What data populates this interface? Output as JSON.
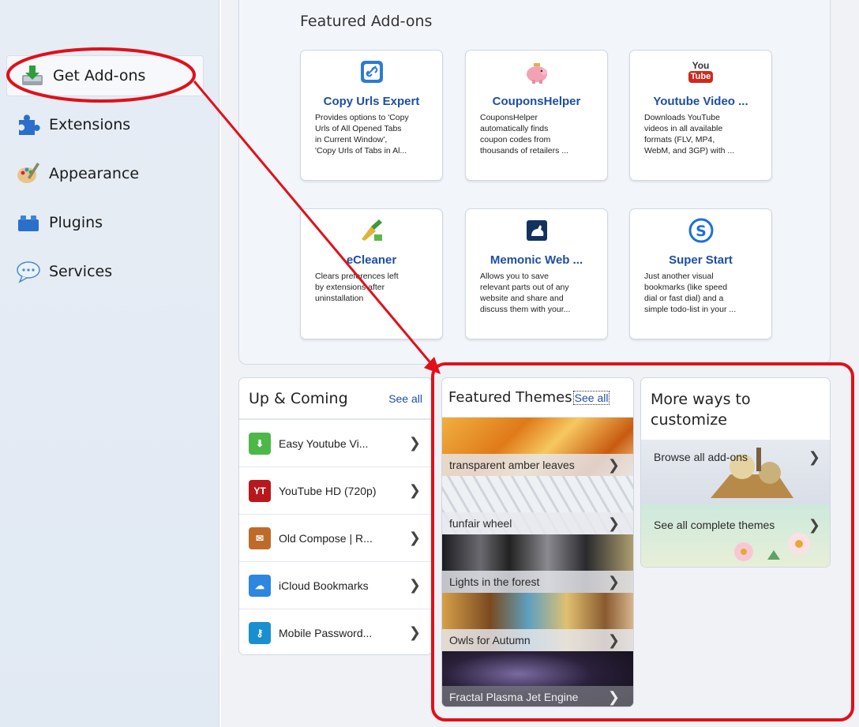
{
  "sidebar": {
    "items": [
      {
        "label": "Get Add-ons",
        "icon": "download-icon"
      },
      {
        "label": "Extensions",
        "icon": "puzzle-icon"
      },
      {
        "label": "Appearance",
        "icon": "paintbrush-icon"
      },
      {
        "label": "Plugins",
        "icon": "lego-icon"
      },
      {
        "label": "Services",
        "icon": "chat-icon"
      }
    ]
  },
  "featured": {
    "title": "Featured Add-ons",
    "cards": [
      {
        "title": "Copy Urls Expert",
        "desc": "Provides options to 'Copy\nUrls of All Opened Tabs\nin Current Window',\n'Copy Urls of Tabs in Al...",
        "icon": "link-icon"
      },
      {
        "title": "CouponsHelper",
        "desc": "CouponsHelper\nautomatically finds\ncoupon codes from\nthousands of retailers ...",
        "icon": "piggy-bank-icon"
      },
      {
        "title": "Youtube Video ...",
        "desc": "Downloads YouTube\nvideos in all available\nformats (FLV, MP4,\nWebM, and 3GP) with ...",
        "icon": "youtube-icon",
        "icon_text_top": "You",
        "icon_text_bottom": "Tube"
      },
      {
        "title": "eCleaner",
        "desc": "Clears preferences left\nby extensions after\nuninstallation",
        "icon": "broom-icon"
      },
      {
        "title": "Memonic Web ...",
        "desc": "Allows you to save\nrelevant parts out of any\nwebsite and share and\ndiscuss them with your...",
        "icon": "squirrel-icon"
      },
      {
        "title": "Super Start",
        "desc": "Just another visual\nbookmarks (like speed\ndial or fast dial) and a\nsimple todo-list in your ...",
        "icon": "s-circle-icon"
      }
    ]
  },
  "up_coming": {
    "title": "Up & Coming",
    "see_all": "See all",
    "items": [
      {
        "label": "Easy Youtube Vi...",
        "icon": "download-folder-icon"
      },
      {
        "label": "YouTube HD (720p)",
        "icon": "yt-hd-icon",
        "icon_text": "YT"
      },
      {
        "label": "Old Compose | R...",
        "icon": "compose-icon"
      },
      {
        "label": "iCloud Bookmarks",
        "icon": "cloud-icon"
      },
      {
        "label": "Mobile Password...",
        "icon": "key-icon"
      }
    ]
  },
  "featured_themes": {
    "title": "Featured Themes",
    "see_all": "See all",
    "items": [
      {
        "label": "transparent amber leaves"
      },
      {
        "label": "funfair wheel"
      },
      {
        "label": "Lights in the forest"
      },
      {
        "label": "Owls for Autumn"
      },
      {
        "label": "Fractal Plasma Jet Engine"
      }
    ]
  },
  "more_ways": {
    "title": "More ways to customize",
    "items": [
      {
        "label": "Browse all add-ons"
      },
      {
        "label": "See all complete themes"
      }
    ]
  },
  "chevron": "❯",
  "colors": {
    "annotation_red": "#e0101a",
    "link_blue": "#1d4fa3"
  }
}
